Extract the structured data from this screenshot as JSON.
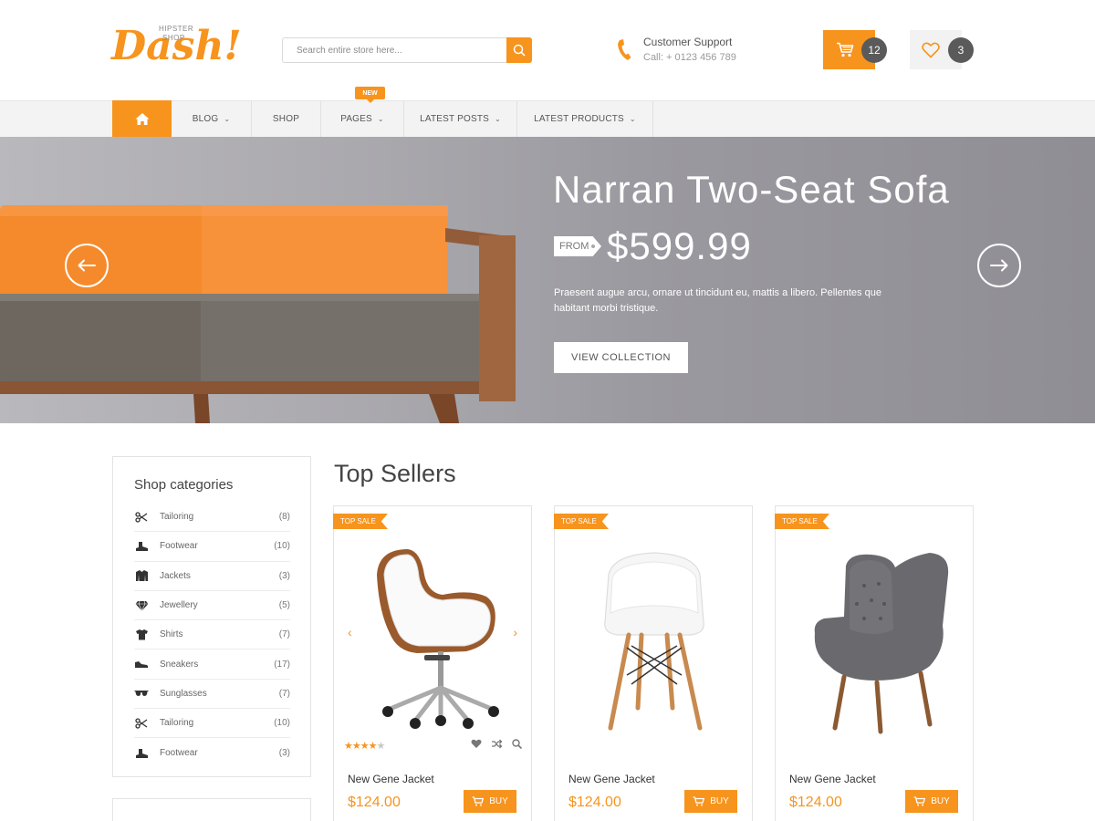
{
  "header": {
    "logo_tagline_1": "HIPSTER",
    "logo_tagline_2": "SHOP",
    "logo_text": "Dash!",
    "search_placeholder": "Search entire store here...",
    "support_title": "Customer Support",
    "support_phone": "Call: + 0123 456 789",
    "cart_count": "12",
    "wishlist_count": "3",
    "accent_color": "#f7941d"
  },
  "nav": {
    "items": [
      {
        "label": "BLOG",
        "has_dropdown": true
      },
      {
        "label": "SHOP",
        "has_dropdown": false
      },
      {
        "label": "PAGES",
        "has_dropdown": true
      },
      {
        "label": "LATEST POSTS",
        "has_dropdown": true
      },
      {
        "label": "LATEST PRODUCTS",
        "has_dropdown": true
      }
    ],
    "new_badge": "NEW"
  },
  "hero": {
    "title": "Narran Two-Seat Sofa",
    "from_label": "FROM",
    "price": "$599.99",
    "description": "Praesent augue arcu, ornare ut  tincidunt eu, mattis a libero. Pellentes que habitant morbi tristique.",
    "button_label": "VIEW COLLECTION"
  },
  "sidebar": {
    "title": "Shop categories",
    "categories": [
      {
        "label": "Tailoring",
        "count": "(8)",
        "icon": "scissors-icon"
      },
      {
        "label": "Footwear",
        "count": "(10)",
        "icon": "boot-icon"
      },
      {
        "label": "Jackets",
        "count": "(3)",
        "icon": "jacket-icon"
      },
      {
        "label": "Jewellery",
        "count": "(5)",
        "icon": "diamond-icon"
      },
      {
        "label": "Shirts",
        "count": "(7)",
        "icon": "shirt-icon"
      },
      {
        "label": "Sneakers",
        "count": "(17)",
        "icon": "sneaker-icon"
      },
      {
        "label": "Sunglasses",
        "count": "(7)",
        "icon": "sunglasses-icon"
      },
      {
        "label": "Tailoring",
        "count": "(10)",
        "icon": "scissors-icon"
      },
      {
        "label": "Footwear",
        "count": "(3)",
        "icon": "boot-icon"
      }
    ]
  },
  "products": {
    "section_title": "Top Sellers",
    "items": [
      {
        "ribbon": "TOP SALE",
        "name": "New Gene Jacket",
        "price": "$124.00",
        "buy_label": "BUY",
        "rating": 4,
        "rating_max": 5
      },
      {
        "ribbon": "TOP SALE",
        "name": "New Gene Jacket",
        "price": "$124.00",
        "buy_label": "BUY"
      },
      {
        "ribbon": "TOP SALE",
        "name": "New Gene Jacket",
        "price": "$124.00",
        "buy_label": "BUY"
      }
    ]
  }
}
